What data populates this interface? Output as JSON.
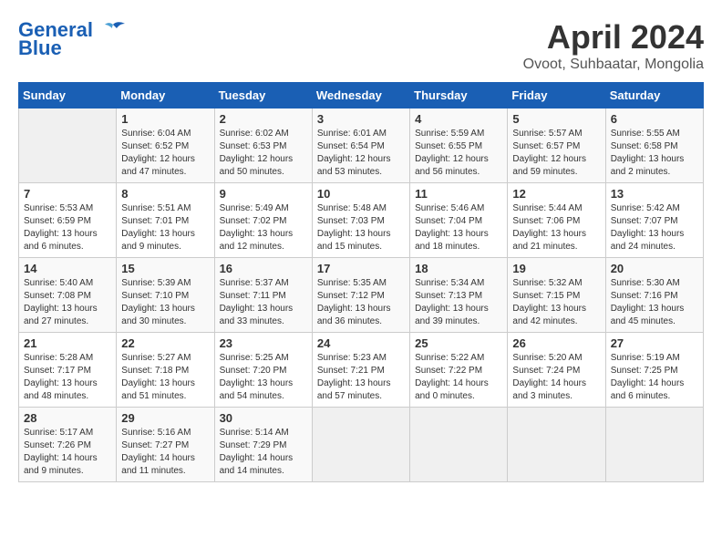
{
  "header": {
    "logo_line1": "General",
    "logo_line2": "Blue",
    "month_title": "April 2024",
    "location": "Ovoot, Suhbaatar, Mongolia"
  },
  "calendar": {
    "weekdays": [
      "Sunday",
      "Monday",
      "Tuesday",
      "Wednesday",
      "Thursday",
      "Friday",
      "Saturday"
    ],
    "weeks": [
      [
        {
          "day": "",
          "empty": true
        },
        {
          "day": "1",
          "sunrise": "6:04 AM",
          "sunset": "6:52 PM",
          "daylight": "12 hours and 47 minutes."
        },
        {
          "day": "2",
          "sunrise": "6:02 AM",
          "sunset": "6:53 PM",
          "daylight": "12 hours and 50 minutes."
        },
        {
          "day": "3",
          "sunrise": "6:01 AM",
          "sunset": "6:54 PM",
          "daylight": "12 hours and 53 minutes."
        },
        {
          "day": "4",
          "sunrise": "5:59 AM",
          "sunset": "6:55 PM",
          "daylight": "12 hours and 56 minutes."
        },
        {
          "day": "5",
          "sunrise": "5:57 AM",
          "sunset": "6:57 PM",
          "daylight": "12 hours and 59 minutes."
        },
        {
          "day": "6",
          "sunrise": "5:55 AM",
          "sunset": "6:58 PM",
          "daylight": "13 hours and 2 minutes."
        }
      ],
      [
        {
          "day": "7",
          "sunrise": "5:53 AM",
          "sunset": "6:59 PM",
          "daylight": "13 hours and 6 minutes."
        },
        {
          "day": "8",
          "sunrise": "5:51 AM",
          "sunset": "7:01 PM",
          "daylight": "13 hours and 9 minutes."
        },
        {
          "day": "9",
          "sunrise": "5:49 AM",
          "sunset": "7:02 PM",
          "daylight": "13 hours and 12 minutes."
        },
        {
          "day": "10",
          "sunrise": "5:48 AM",
          "sunset": "7:03 PM",
          "daylight": "13 hours and 15 minutes."
        },
        {
          "day": "11",
          "sunrise": "5:46 AM",
          "sunset": "7:04 PM",
          "daylight": "13 hours and 18 minutes."
        },
        {
          "day": "12",
          "sunrise": "5:44 AM",
          "sunset": "7:06 PM",
          "daylight": "13 hours and 21 minutes."
        },
        {
          "day": "13",
          "sunrise": "5:42 AM",
          "sunset": "7:07 PM",
          "daylight": "13 hours and 24 minutes."
        }
      ],
      [
        {
          "day": "14",
          "sunrise": "5:40 AM",
          "sunset": "7:08 PM",
          "daylight": "13 hours and 27 minutes."
        },
        {
          "day": "15",
          "sunrise": "5:39 AM",
          "sunset": "7:10 PM",
          "daylight": "13 hours and 30 minutes."
        },
        {
          "day": "16",
          "sunrise": "5:37 AM",
          "sunset": "7:11 PM",
          "daylight": "13 hours and 33 minutes."
        },
        {
          "day": "17",
          "sunrise": "5:35 AM",
          "sunset": "7:12 PM",
          "daylight": "13 hours and 36 minutes."
        },
        {
          "day": "18",
          "sunrise": "5:34 AM",
          "sunset": "7:13 PM",
          "daylight": "13 hours and 39 minutes."
        },
        {
          "day": "19",
          "sunrise": "5:32 AM",
          "sunset": "7:15 PM",
          "daylight": "13 hours and 42 minutes."
        },
        {
          "day": "20",
          "sunrise": "5:30 AM",
          "sunset": "7:16 PM",
          "daylight": "13 hours and 45 minutes."
        }
      ],
      [
        {
          "day": "21",
          "sunrise": "5:28 AM",
          "sunset": "7:17 PM",
          "daylight": "13 hours and 48 minutes."
        },
        {
          "day": "22",
          "sunrise": "5:27 AM",
          "sunset": "7:18 PM",
          "daylight": "13 hours and 51 minutes."
        },
        {
          "day": "23",
          "sunrise": "5:25 AM",
          "sunset": "7:20 PM",
          "daylight": "13 hours and 54 minutes."
        },
        {
          "day": "24",
          "sunrise": "5:23 AM",
          "sunset": "7:21 PM",
          "daylight": "13 hours and 57 minutes."
        },
        {
          "day": "25",
          "sunrise": "5:22 AM",
          "sunset": "7:22 PM",
          "daylight": "14 hours and 0 minutes."
        },
        {
          "day": "26",
          "sunrise": "5:20 AM",
          "sunset": "7:24 PM",
          "daylight": "14 hours and 3 minutes."
        },
        {
          "day": "27",
          "sunrise": "5:19 AM",
          "sunset": "7:25 PM",
          "daylight": "14 hours and 6 minutes."
        }
      ],
      [
        {
          "day": "28",
          "sunrise": "5:17 AM",
          "sunset": "7:26 PM",
          "daylight": "14 hours and 9 minutes."
        },
        {
          "day": "29",
          "sunrise": "5:16 AM",
          "sunset": "7:27 PM",
          "daylight": "14 hours and 11 minutes."
        },
        {
          "day": "30",
          "sunrise": "5:14 AM",
          "sunset": "7:29 PM",
          "daylight": "14 hours and 14 minutes."
        },
        {
          "day": "",
          "empty": true
        },
        {
          "day": "",
          "empty": true
        },
        {
          "day": "",
          "empty": true
        },
        {
          "day": "",
          "empty": true
        }
      ]
    ]
  }
}
